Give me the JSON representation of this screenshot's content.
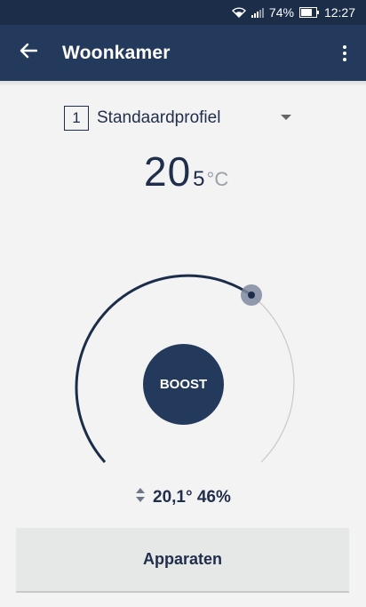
{
  "statusbar": {
    "battery": "74%",
    "time": "12:27"
  },
  "appbar": {
    "title": "Woonkamer",
    "back_icon": "arrow-left-icon",
    "menu_icon": "more-vert-icon"
  },
  "profile": {
    "number": "1",
    "name": "Standaardprofiel"
  },
  "setpoint": {
    "whole": "20",
    "decimal": "5",
    "unit": "°C"
  },
  "dial": {
    "colors": {
      "active": "#1c2d4a",
      "inactive": "#c9c9c9",
      "knob": "#7f8aa0"
    }
  },
  "boost_label": "BOOST",
  "current": {
    "text": "20,1° 46%"
  },
  "devices_label": "Apparaten"
}
